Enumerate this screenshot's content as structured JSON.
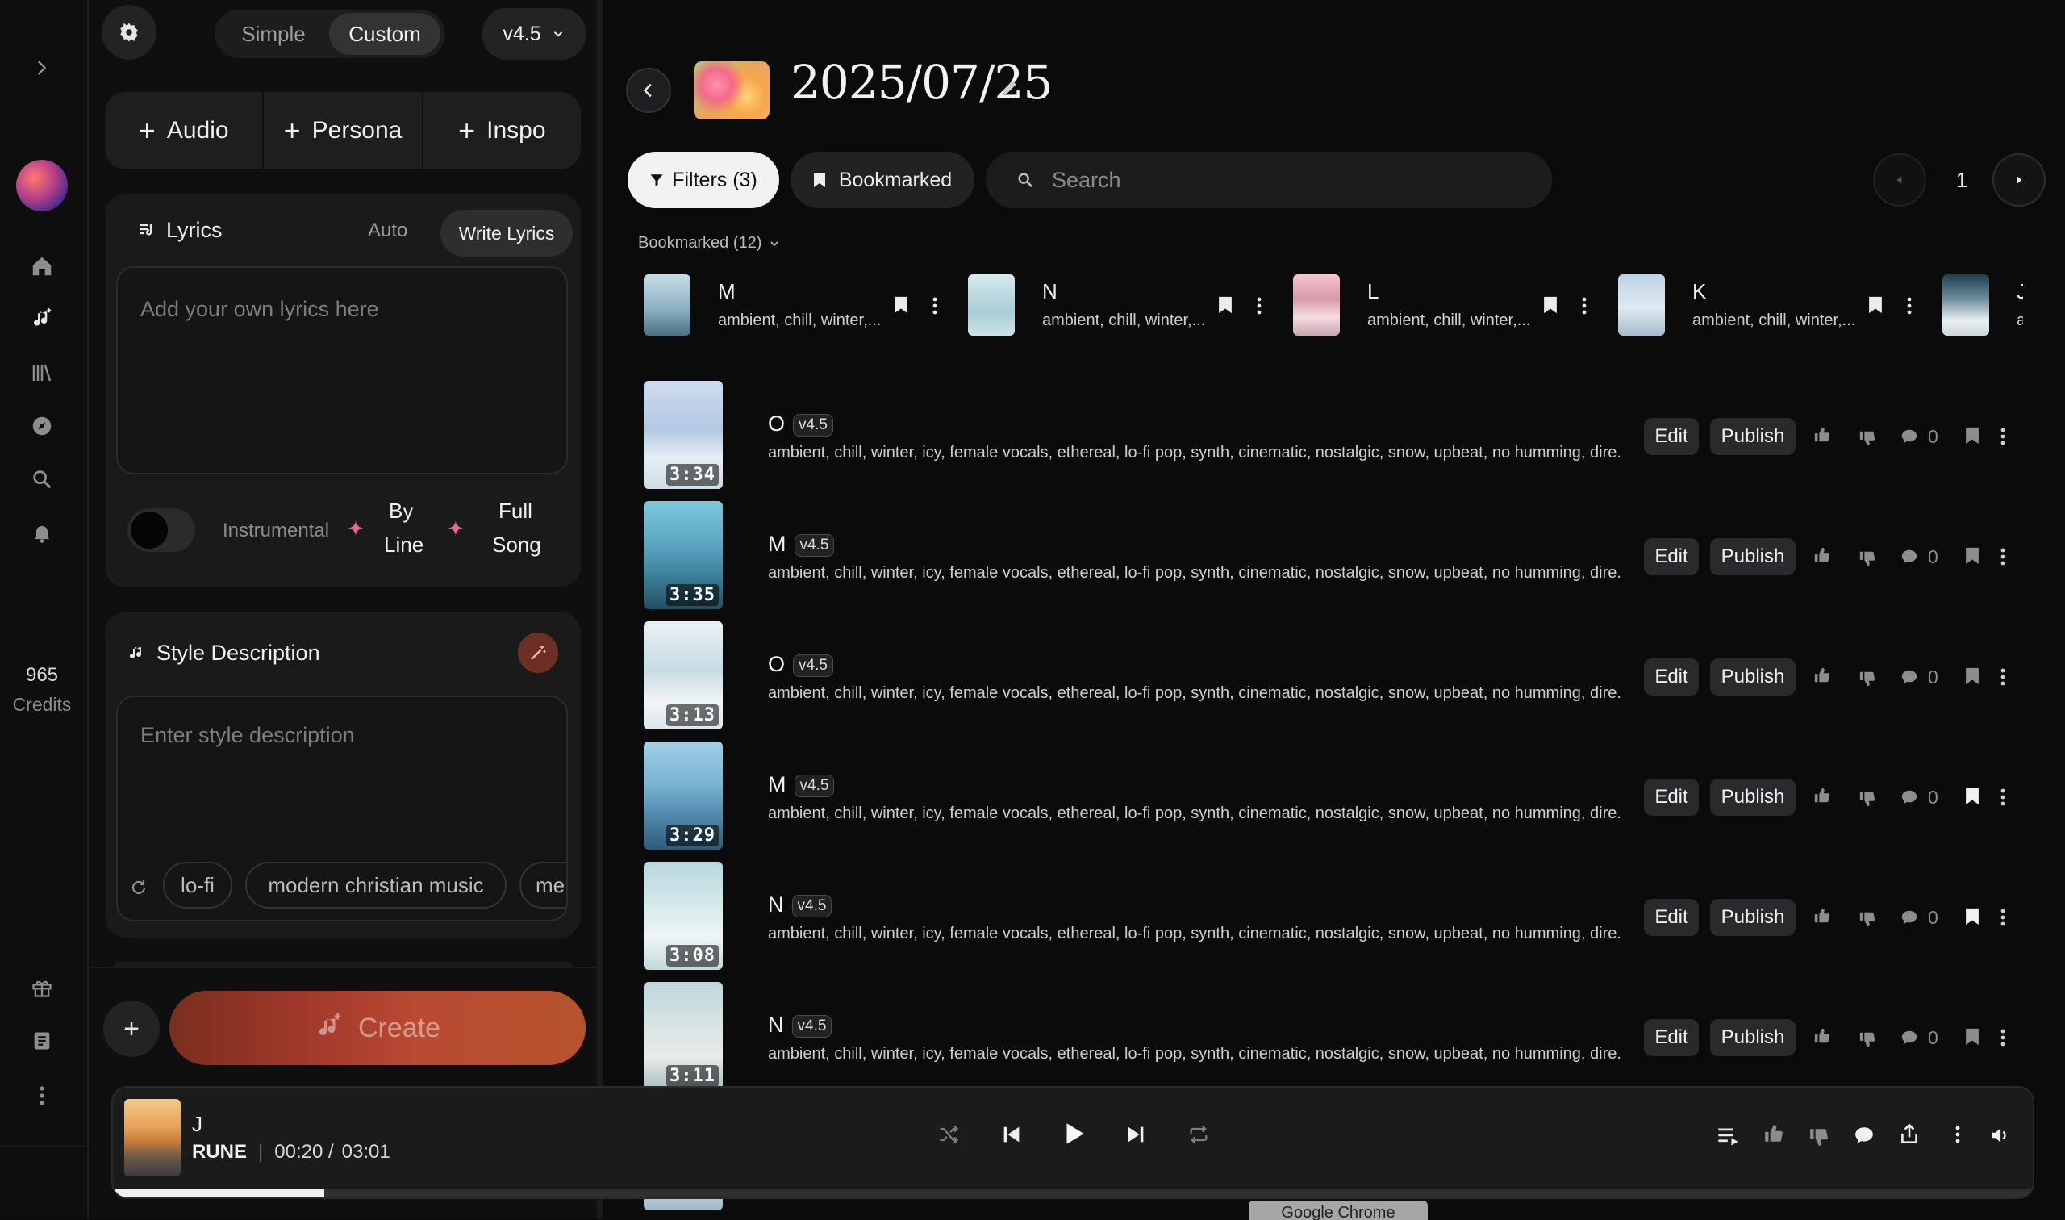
{
  "rail": {
    "credits_count": "965",
    "credits_label": "Credits"
  },
  "panel": {
    "mode_simple": "Simple",
    "mode_custom": "Custom",
    "model_version": "v4.5",
    "add_audio": "Audio",
    "add_persona": "Persona",
    "add_inspo": "Inspo",
    "lyrics_title": "Lyrics",
    "lyrics_auto": "Auto",
    "lyrics_write": "Write Lyrics",
    "lyrics_placeholder": "Add your own lyrics here",
    "instrumental_label": "Instrumental",
    "by_line_1": "By",
    "by_line_2": "Line",
    "full_song_1": "Full",
    "full_song_2": "Song",
    "style_title": "Style Description",
    "style_placeholder": "Enter style description",
    "style_tags": [
      "lo-fi",
      "modern christian music",
      "me"
    ],
    "create_label": "Create"
  },
  "header": {
    "workspace_title": "2025/07/25"
  },
  "toolbar": {
    "filters_label": "Filters (3)",
    "bookmarked_label": "Bookmarked",
    "search_placeholder": "Search",
    "page_number": "1"
  },
  "bookmarked_strip": {
    "heading": "Bookmarked (12)",
    "items": [
      {
        "title": "M",
        "tags": "ambient, chill, winter,..."
      },
      {
        "title": "N",
        "tags": "ambient, chill, winter,..."
      },
      {
        "title": "L",
        "tags": "ambient, chill, winter,..."
      },
      {
        "title": "K",
        "tags": "ambient, chill, winter,..."
      },
      {
        "title": "J",
        "tags": "a"
      }
    ]
  },
  "songs": {
    "edit_label": "Edit",
    "publish_label": "Publish",
    "rows": [
      {
        "title": "O",
        "version": "v4.5",
        "duration": "3:34",
        "comments": "0",
        "bookmarked": false,
        "tags": "ambient, chill, winter, icy, female vocals, ethereal, lo-fi pop, synth, cinematic, nostalgic, snow, upbeat, no humming, dire..."
      },
      {
        "title": "M",
        "version": "v4.5",
        "duration": "3:35",
        "comments": "0",
        "bookmarked": false,
        "tags": "ambient, chill, winter, icy, female vocals, ethereal, lo-fi pop, synth, cinematic, nostalgic, snow, upbeat, no humming, dire..."
      },
      {
        "title": "O",
        "version": "v4.5",
        "duration": "3:13",
        "comments": "0",
        "bookmarked": false,
        "tags": "ambient, chill, winter, icy, female vocals, ethereal, lo-fi pop, synth, cinematic, nostalgic, snow, upbeat, no humming, dire..."
      },
      {
        "title": "M",
        "version": "v4.5",
        "duration": "3:29",
        "comments": "0",
        "bookmarked": true,
        "tags": "ambient, chill, winter, icy, female vocals, ethereal, lo-fi pop, synth, cinematic, nostalgic, snow, upbeat, no humming, dire..."
      },
      {
        "title": "N",
        "version": "v4.5",
        "duration": "3:08",
        "comments": "0",
        "bookmarked": true,
        "tags": "ambient, chill, winter, icy, female vocals, ethereal, lo-fi pop, synth, cinematic, nostalgic, snow, upbeat, no humming, dire..."
      },
      {
        "title": "N",
        "version": "v4.5",
        "duration": "3:11",
        "comments": "0",
        "bookmarked": false,
        "tags": "ambient, chill, winter, icy, female vocals, ethereal, lo-fi pop, synth, cinematic, nostalgic, snow, upbeat, no humming, dire..."
      }
    ]
  },
  "player": {
    "track_title": "J",
    "artist": "RUNE",
    "separator": "|",
    "elapsed": "00:20 /",
    "total": "03:01",
    "progress_fraction": 0.11
  },
  "overlay": {
    "tooltip_text": "Google Chrome"
  }
}
